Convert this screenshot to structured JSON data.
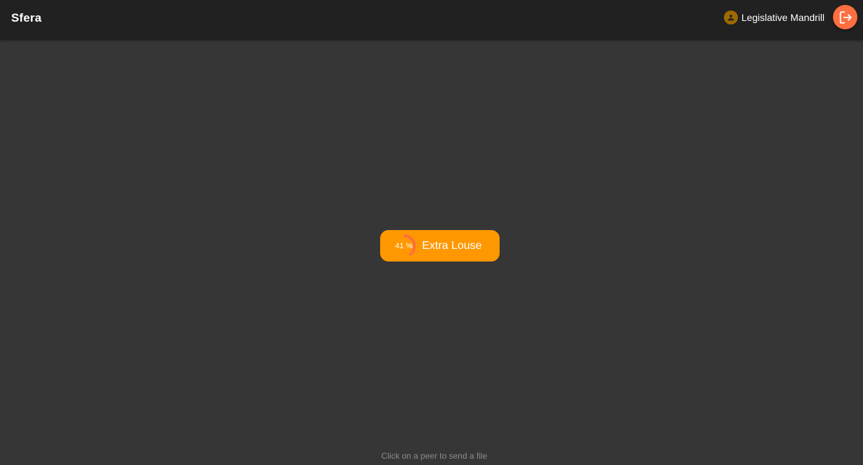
{
  "app": {
    "title": "Sfera"
  },
  "header": {
    "user": {
      "name": "Legislative Mandrill",
      "icon": "person-icon"
    },
    "logout": {
      "icon": "logout-icon"
    }
  },
  "peers": [
    {
      "name": "Extra Louse",
      "progress": 0.41,
      "progress_label": "41 %"
    }
  ],
  "footer": {
    "hint": "Click on a peer to send a file"
  },
  "colors": {
    "topbar": "#212121",
    "background": "#363636",
    "peer_chip": "#ff9800",
    "progress_ring": "#ff6e40",
    "logout_button": "#ff6e40",
    "avatar": "#9e6a00"
  }
}
